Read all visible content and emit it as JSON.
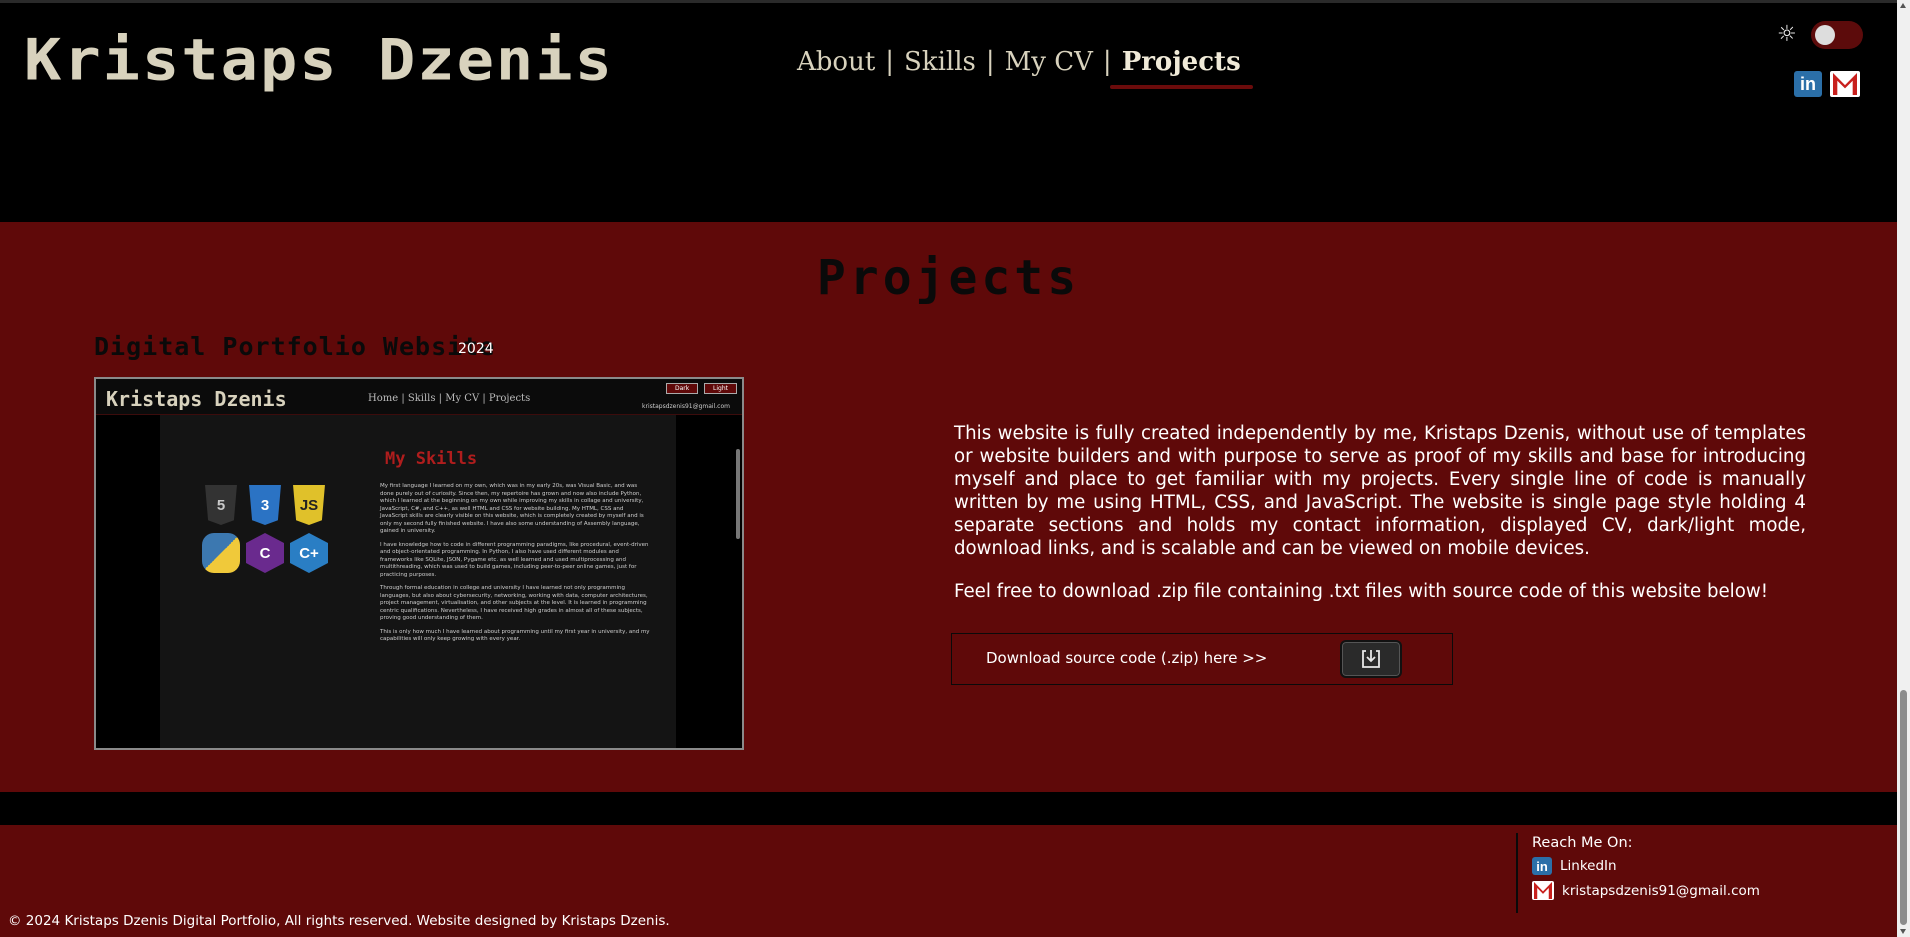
{
  "header": {
    "brand": "Kristaps Dzenis",
    "nav": [
      {
        "label": "About"
      },
      {
        "label": "Skills"
      },
      {
        "label": "My CV"
      },
      {
        "label": "Projects"
      }
    ],
    "separator": "|",
    "theme_icon": "sun-icon",
    "theme_toggle": "off",
    "social": [
      "linkedin-icon",
      "gmail-icon"
    ]
  },
  "projects": {
    "title": "Projects",
    "item": {
      "name": "Digital Portfolio Website",
      "year": "2024",
      "description": "This website is fully created independently by me, Kristaps Dzenis, without use of templates or website builders and with purpose to serve as proof of my skills and base for introducing myself and place to get familiar with my projects. Every single line of code is manually written by me using HTML, CSS, and JavaScript. The website is single page style holding 4 separate sections and holds my contact information, displayed CV, dark/light mode, download links, and is scalable and can be viewed on mobile devices.",
      "note": "Feel free to download .zip file containing .txt files with source code of this website below!",
      "download_label": "Download source code (.zip) here >>",
      "download_icon": "download-icon",
      "screenshot": {
        "brand": "Kristaps Dzenis",
        "nav": "Home | Skills | My CV | Projects",
        "dark_btn": "Dark",
        "light_btn": "Light",
        "email": "kristapsdzenis91@gmail.com",
        "section_title": "My Skills",
        "icons": [
          "HTML",
          "CSS",
          "JS",
          "Py",
          "C",
          "C++"
        ],
        "icon_text": [
          "5",
          "3",
          "JS",
          "",
          "C",
          "C+"
        ],
        "paragraphs": [
          "My first language I learned on my own, which was in my early 20s, was Visual Basic, and was done purely out of curiosity. Since then, my repertoire has grown and now also include Python, which I learned at the beginning on my own while improving my skills in collage and university, JavaScript, C#, and C++, as well HTML and CSS for website building. My HTML, CSS and JavaScript skills are clearly visible on this website, which is completely created by myself and is only my second fully finished website. I have also some understanding of Assembly language, gained in university.",
          "I have knowledge how to code in different programming paradigms, like procedural, event-driven and object-orientated programming. In Python, I also have used different modules and frameworks like SQLite, JSON, Pygame etc. as well learned and used multiprocessing and multithreading, which was used to build games, including peer-to-peer online games, just for practicing purposes.",
          "Through formal education in college and university I have learned not only programming languages, but also about cybersecurity, networking, working with data, computer architectures, project management, virtualisation, and other subjects at the level. It is learned in programming centric qualifications. Nevertheless, I have received high grades in almost all of these subjects, proving good understanding of them.",
          "This is only how much I have learned about programming until my first year in university, and my capabilities will only keep growing with every year."
        ]
      }
    }
  },
  "footer": {
    "reach_title": "Reach Me On:",
    "linkedin_label": "LinkedIn",
    "email_label": "kristapsdzenis91@gmail.com",
    "copyright": "© 2024 Kristaps Dzenis Digital Portfolio, All rights reserved. Website designed by Kristaps Dzenis."
  }
}
